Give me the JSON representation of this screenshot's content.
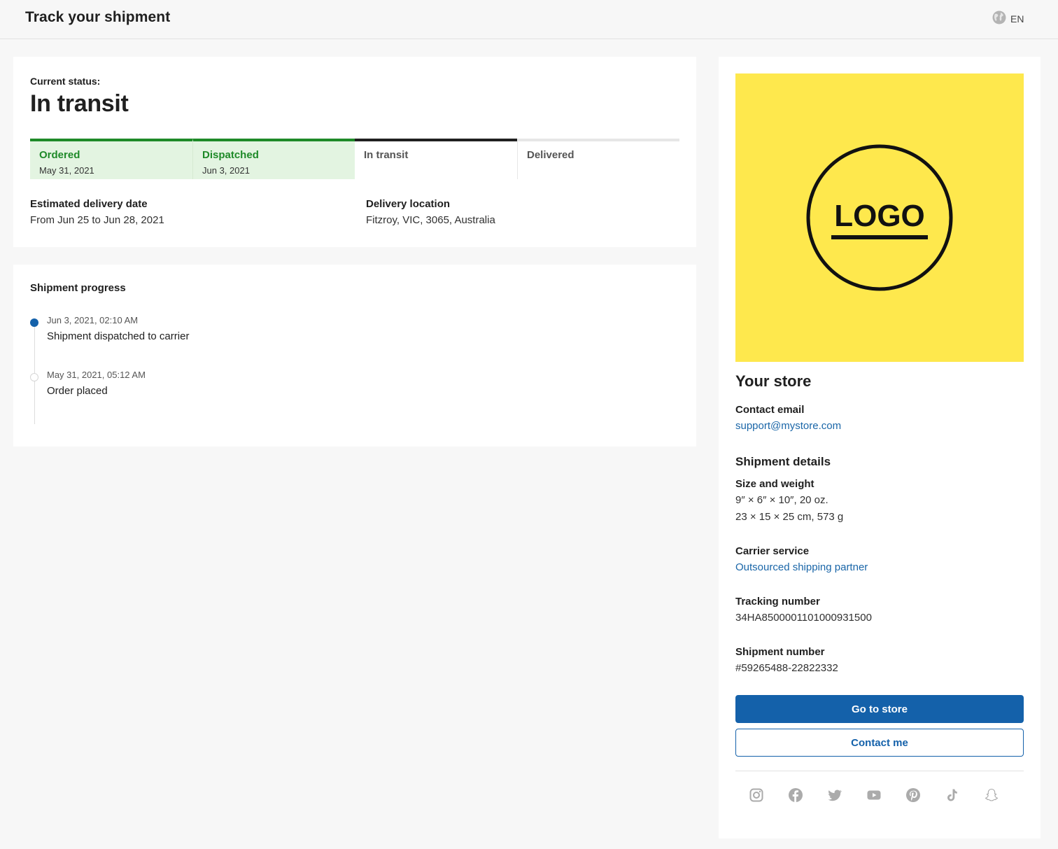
{
  "header": {
    "title": "Track your shipment",
    "language": "EN",
    "language_icon": "globe-icon"
  },
  "status": {
    "label": "Current status:",
    "value": "In transit",
    "steps": [
      {
        "name": "Ordered",
        "date": "May 31, 2021",
        "state": "done"
      },
      {
        "name": "Dispatched",
        "date": "Jun 3, 2021",
        "state": "done"
      },
      {
        "name": "In transit",
        "date": "",
        "state": "current"
      },
      {
        "name": "Delivered",
        "date": "",
        "state": "pending"
      }
    ],
    "estimated_delivery": {
      "label": "Estimated delivery date",
      "value": "From Jun 25 to Jun 28, 2021"
    },
    "delivery_location": {
      "label": "Delivery location",
      "value": "Fitzroy, VIC, 3065, Australia"
    }
  },
  "progress": {
    "title": "Shipment progress",
    "events": [
      {
        "time": "Jun 3, 2021, 02:10 AM",
        "description": "Shipment dispatched to carrier",
        "active": true
      },
      {
        "time": "May 31, 2021, 05:12 AM",
        "description": "Order placed",
        "active": false
      }
    ]
  },
  "store": {
    "logo_text": "LOGO",
    "name": "Your store",
    "contact_email": {
      "label": "Contact email",
      "value": "support@mystore.com"
    },
    "shipment_details_title": "Shipment details",
    "size_weight": {
      "label": "Size and weight",
      "imperial": "9″ × 6″ × 10″, 20 oz.",
      "metric": "23 × 15 × 25 cm, 573 g"
    },
    "carrier_service": {
      "label": "Carrier service",
      "value": "Outsourced shipping partner"
    },
    "tracking_number": {
      "label": "Tracking number",
      "value": "34HA8500001101000931500"
    },
    "shipment_number": {
      "label": "Shipment number",
      "value": "#59265488-22822332"
    },
    "go_to_store_label": "Go to store",
    "contact_me_label": "Contact me",
    "socials": [
      "instagram-icon",
      "facebook-icon",
      "twitter-icon",
      "youtube-icon",
      "pinterest-icon",
      "tiktok-icon",
      "snapchat-icon"
    ]
  },
  "colors": {
    "primary": "#1461aa",
    "success": "#1e8a28",
    "success_bg": "#e3f4e1",
    "logo_bg": "#fee84d",
    "icon_gray": "#ababab"
  }
}
